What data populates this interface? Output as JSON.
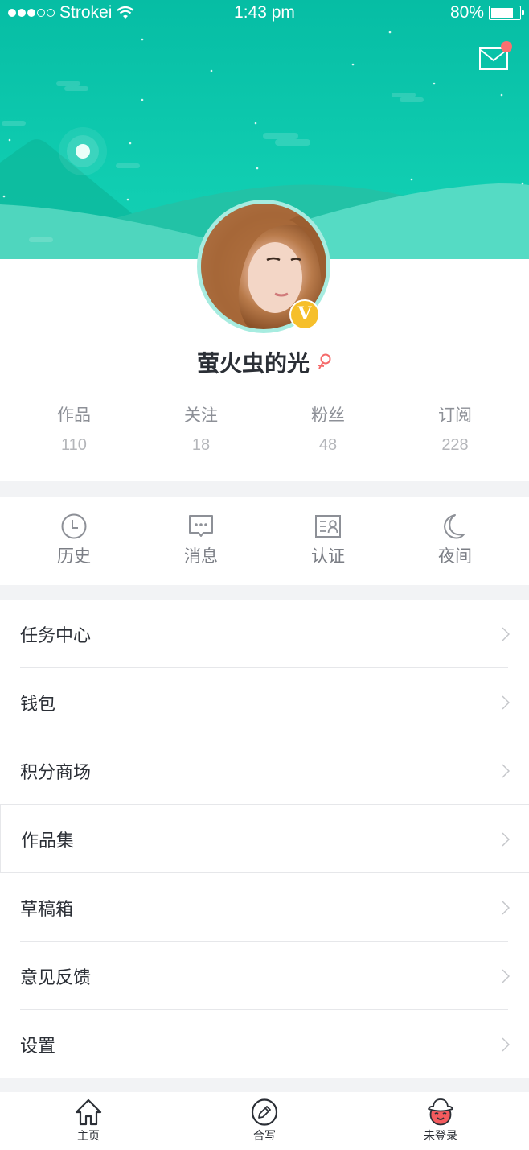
{
  "status_bar": {
    "signal_bars_filled": 3,
    "signal_bars_total": 5,
    "carrier": "Strokei",
    "wifi_icon": "wifi-icon",
    "time": "1:43 pm",
    "battery_percent": "80%",
    "battery_level": 0.8
  },
  "header": {
    "mail_icon": "mail-icon",
    "has_unread_badge": true,
    "background_color": "#0fc8ad",
    "badge_color": "#fb6f70"
  },
  "profile": {
    "username": "萤火虫的光",
    "verified_badge": "V",
    "gender_icon": "female-icon",
    "gender_color": "#f56a6a",
    "stats": [
      {
        "label": "作品",
        "value": "110"
      },
      {
        "label": "关注",
        "value": "18"
      },
      {
        "label": "粉丝",
        "value": "48"
      },
      {
        "label": "订阅",
        "value": "228"
      }
    ]
  },
  "quick_actions": [
    {
      "label": "历史",
      "icon": "clock-icon"
    },
    {
      "label": "消息",
      "icon": "chat-bubble-icon"
    },
    {
      "label": "认证",
      "icon": "id-card-icon"
    },
    {
      "label": "夜间",
      "icon": "moon-icon"
    }
  ],
  "menu": [
    {
      "label": "任务中心"
    },
    {
      "label": "钱包"
    },
    {
      "label": "积分商场"
    },
    {
      "label": "作品集"
    },
    {
      "label": "草稿箱"
    },
    {
      "label": "意见反馈"
    },
    {
      "label": "设置"
    }
  ],
  "tab_bar": [
    {
      "label": "主页",
      "icon": "home-icon"
    },
    {
      "label": "合写",
      "icon": "pencil-circle-icon"
    },
    {
      "label": "未登录",
      "icon": "guest-avatar-icon"
    }
  ]
}
